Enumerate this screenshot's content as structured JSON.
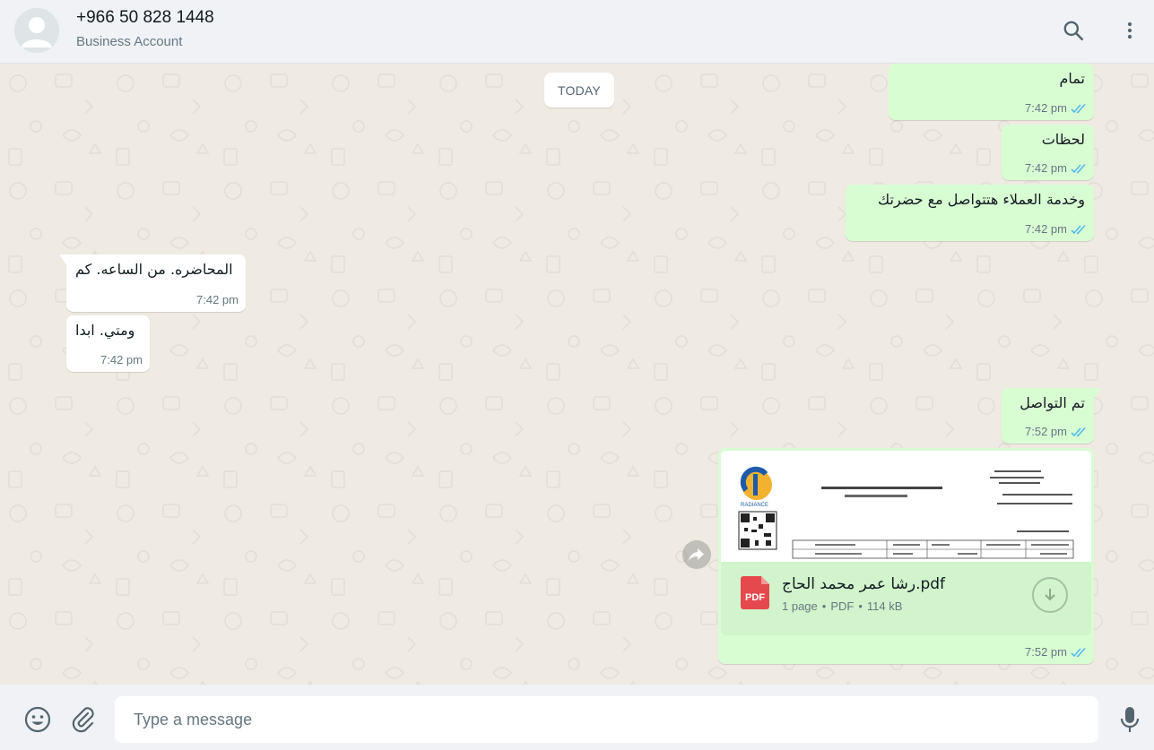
{
  "header": {
    "contact_name": "+966 50 828 1448",
    "contact_subtitle": "Business Account",
    "icons": [
      "search-icon",
      "menu-kebab-icon"
    ]
  },
  "chat": {
    "date_separator": "TODAY",
    "messages": [
      {
        "direction": "out",
        "text": "تمام",
        "time": "7:42 pm",
        "status": "read"
      },
      {
        "direction": "out",
        "text": "لحظات",
        "time": "7:42 pm",
        "status": "read"
      },
      {
        "direction": "out",
        "text": "وخدمة العملاء هتتواصل مع حضرتك",
        "time": "7:42 pm",
        "status": "read"
      },
      {
        "direction": "in",
        "text": "المحاضره. من الساعه. كم",
        "time": "7:42 pm"
      },
      {
        "direction": "in",
        "text": "ومتي. ابدا",
        "time": "7:42 pm"
      },
      {
        "direction": "out",
        "text": "تم التواصل",
        "time": "7:52 pm",
        "status": "read"
      }
    ],
    "document": {
      "file_name": "رشا عمر محمد الحاج.pdf",
      "pages": "1 page",
      "type": "PDF",
      "size": "114 kB",
      "time": "7:52 pm",
      "status": "read",
      "pdf_badge": "PDF",
      "preview_logo_text": "RADIANCE"
    }
  },
  "composer": {
    "placeholder": "Type a message",
    "icons": [
      "emoji-icon",
      "attach-icon",
      "microphone-icon"
    ]
  },
  "colors": {
    "outgoing_bubble": "#d9fdd3",
    "incoming_bubble": "#ffffff",
    "read_ticks": "#53bdeb",
    "chat_background": "#efeae2",
    "pdf_red": "#e5484d"
  }
}
